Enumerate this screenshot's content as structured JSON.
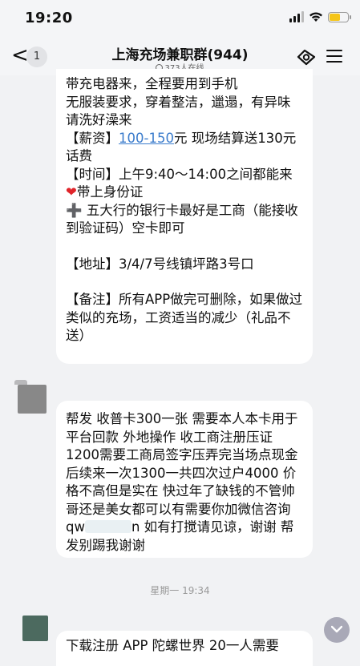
{
  "status_bar": {
    "time": "19:20"
  },
  "nav": {
    "back_glyph": "<",
    "unread_count": "1",
    "title": "上海充场兼职群(944)",
    "online": "373人在线"
  },
  "message1": {
    "lines": [
      "带充电器来，全程要用到手机",
      "无服装要求，穿着整洁，邋遢，有异味请洗好澡来",
      "【薪资】",
      "100-150",
      "元 现场结算送130元话费",
      "【时间】上午9:40～14:00之间都能来",
      "❤",
      "带上身份证",
      "➕ 五大行的银行卡最好是工商（能接收到验证码）空卡即可",
      "【地址】3/4/7号线镇坪路3号口",
      "【备注】所有APP做完可删除，如果做过类似的充场，工资适当的减少（礼品不送）"
    ]
  },
  "message2": {
    "text_before": "帮发 收普卡300一张 需要本人本卡用于平台回款 外地操作 收工商注册压证1200需要工商局签字压弄完当场点现金 后续来一次1300一共四次过户4000 价格不高但是实在 快过年了缺钱的不管帅哥还是美女都可以有需要你加微信咨询qw",
    "text_after": "n 如有打搅请见谅，谢谢 帮发别踢我谢谢"
  },
  "timestamp": "星期一 19:34",
  "message3": {
    "text": "下载注册 APP 陀螺世界 20一人需要"
  },
  "icons": {
    "scroll_down": "chevron-down-icon",
    "nav_right_1": "customer-service-icon",
    "nav_right_2": "menu-icon"
  },
  "colors": {
    "link": "#3b7ccc",
    "heart": "#e0242a",
    "battery": "#f5c518"
  }
}
